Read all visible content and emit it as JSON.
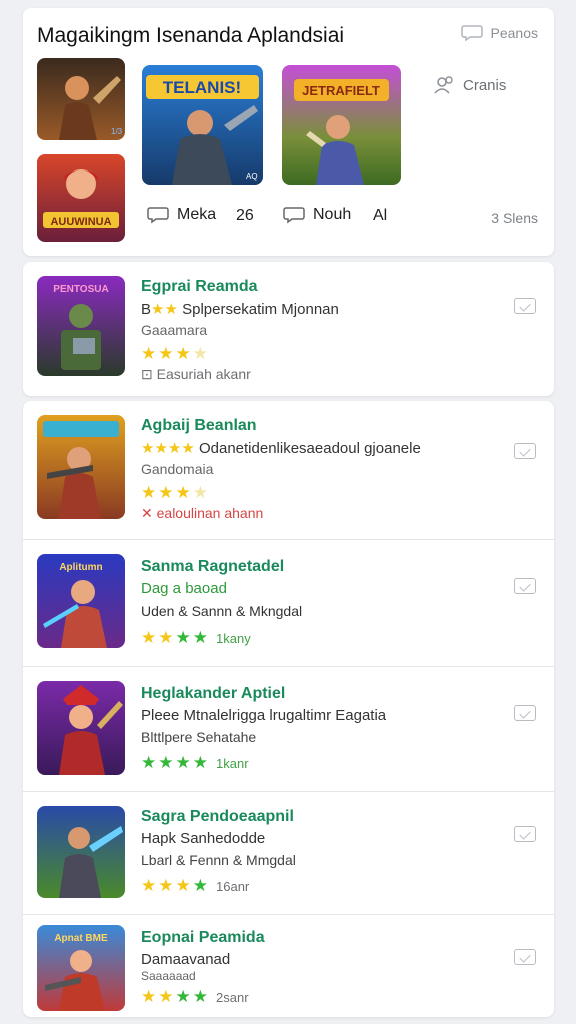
{
  "header": {
    "title": "Magaikingm Isenanda Aplandsiai",
    "link_label": "Peanos"
  },
  "featured": {
    "left_label": "Meka",
    "left_count": "26",
    "middle_label": "Nouh",
    "middle_count": "Al",
    "side_label": "Cranis",
    "bottom_right": "3 Slens",
    "tile_big_title": "TELANIS!",
    "tile_gold_title": "JETRAFIELT",
    "tile_small_title": "AUUWINUA"
  },
  "apps": [
    {
      "name": "Egprai Reamda",
      "line1": "Splpersekatim Mjonnan",
      "line1_prefix": "B",
      "line2": "Gaaamara",
      "downloads": "Easuriah akanr",
      "stars_color": "yellow",
      "rating_text": ""
    },
    {
      "name": "Agbaij Beanlan",
      "line1": "Odanetidenlikesaeadoul gjoanele",
      "line2": "Gandomaia",
      "downloads": "ealoulinan ahann",
      "stars_color": "yellow",
      "rating_text": ""
    },
    {
      "name": "Sanma Ragnetadel",
      "line1": "Dag a baoad",
      "line2": "Uden & Sannn & Mkngdal",
      "downloads": "",
      "stars_color": "mixed",
      "rating_text": "1kany"
    },
    {
      "name": "Heglakander Aptiel",
      "line1": "Pleee Mtnalelrigga lrugaltimr Eagatia",
      "line2": "Blttlpere Sehatahe",
      "downloads": "",
      "stars_color": "green",
      "rating_text": "1kanr"
    },
    {
      "name": "Sagra Pendoeaapnil",
      "line1": "Hapk Sanhedodde",
      "line2": "Lbarl & Fennn & Mmgdal",
      "downloads": "",
      "stars_color": "mixed",
      "rating_text": "16anr"
    },
    {
      "name": "Eopnai Peamida",
      "line1": "Damaavanad",
      "line2": "Saaaaaad",
      "downloads": "",
      "stars_color": "mixed",
      "rating_text": "2sanr"
    }
  ],
  "colors": {
    "app_name": "#1a8a5c",
    "star_yellow": "#f5c518",
    "star_green": "#34b83a",
    "background": "#eef0f3"
  },
  "icons": [
    "chat-bubble-icon",
    "friends-icon",
    "download-status-icon",
    "star-icon"
  ]
}
